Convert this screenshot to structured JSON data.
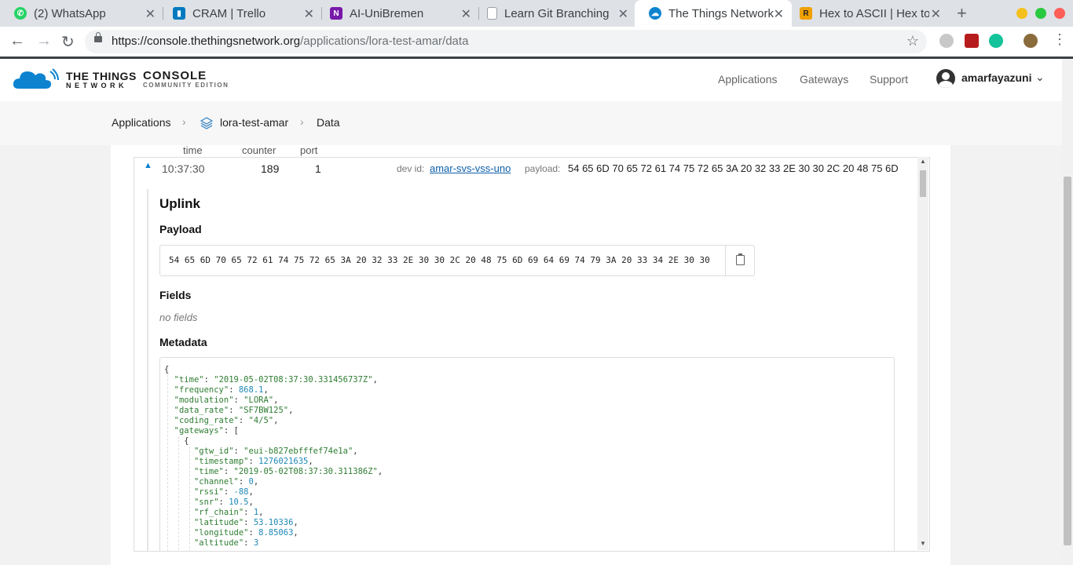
{
  "browser": {
    "tabs": [
      {
        "title": "(2) WhatsApp",
        "favicon": "whatsapp-icon",
        "color": "#25d366"
      },
      {
        "title": "CRAM | Trello",
        "favicon": "trello-icon",
        "color": "#0079bf"
      },
      {
        "title": "AI-UniBremen",
        "favicon": "onenote-icon",
        "color": "#7719aa"
      },
      {
        "title": "Learn Git Branching",
        "favicon": "page-icon",
        "color": "#9aa0a6"
      },
      {
        "title": "The Things Network",
        "favicon": "ttn-cloud-icon",
        "color": "#0d83d0"
      },
      {
        "title": "Hex to ASCII | Hex to",
        "favicon": "r-icon",
        "color": "#f0a000"
      }
    ],
    "url_host": "https://console.thethingsnetwork.org",
    "url_path": "/applications/lora-test-amar/data"
  },
  "header": {
    "brand_line1": "THE THINGS",
    "brand_line2": "NETWORK",
    "console": "CONSOLE",
    "edition": "COMMUNITY EDITION",
    "nav": [
      "Applications",
      "Gateways",
      "Support"
    ],
    "username": "amarfayazuni"
  },
  "breadcrumb": {
    "root": "Applications",
    "app": "lora-test-amar",
    "page": "Data"
  },
  "table": {
    "columns": [
      "time",
      "counter",
      "port"
    ]
  },
  "message": {
    "time": "10:37:30",
    "counter": "189",
    "port": "1",
    "dev_id_label": "dev id:",
    "dev_id": "amar-svs-vss-uno",
    "payload_label": "payload:",
    "payload_short": "54 65 6D 70 65 72 61 74 75 72 65 3A 20 32 33 2E 30 30 2C 20 48 75 6D"
  },
  "detail": {
    "title": "Uplink",
    "payload_heading": "Payload",
    "payload_hex": "54 65 6D 70 65 72 61 74 75 72 65 3A 20 32 33 2E 30 30 2C 20 48 75 6D 69 64 69 74 79 3A 20 33 34 2E 30 30",
    "fields_heading": "Fields",
    "no_fields": "no fields",
    "metadata_heading": "Metadata"
  },
  "metadata": {
    "time": "2019-05-02T08:37:30.331456737Z",
    "frequency": "868.1",
    "modulation": "LORA",
    "data_rate": "SF7BW125",
    "coding_rate": "4/5",
    "gateway": {
      "gtw_id": "eui-b827ebfffef74e1a",
      "timestamp": "1276021635",
      "time": "2019-05-02T08:37:30.311386Z",
      "channel": "0",
      "rssi": "-88",
      "snr": "10.5",
      "rf_chain": "1",
      "latitude": "53.10336",
      "longitude": "8.85063",
      "altitude": "3"
    }
  },
  "colors": {
    "ttn_blue": "#0d83d0",
    "link": "#0d5fa8",
    "json_key": "#2e7d32",
    "json_number": "#1e88b5"
  }
}
